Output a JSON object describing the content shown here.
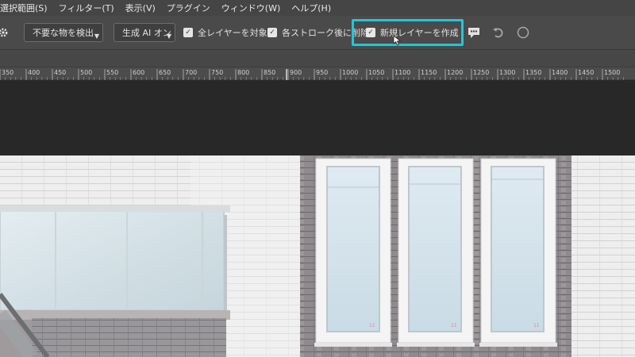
{
  "menu": {
    "items": [
      "選択範囲(S)",
      "フィルター(T)",
      "表示(V)",
      "プラグイン",
      "ウィンドウ(W)",
      "ヘルプ(H)"
    ]
  },
  "options": {
    "mode_dropdown": "不要な物を検出",
    "ai_dropdown": "生成 AI オン",
    "checkbox_all_layers": "全レイヤーを対象",
    "checkbox_delete_after": "各ストローク後に削除",
    "checkbox_new_layer": "新規レイヤーを作成",
    "checkbox_all_layers_checked": true,
    "checkbox_delete_after_checked": true,
    "checkbox_new_layer_checked": true,
    "highlight_color": "#1fc8d8"
  },
  "ruler": {
    "labels": [
      "350",
      "400",
      "450",
      "500",
      "550",
      "600",
      "650",
      "700",
      "750",
      "800",
      "850",
      "900",
      "950",
      "1000",
      "1050",
      "1100",
      "1150",
      "1200",
      "1250",
      "1300",
      "1350",
      "1400",
      "1450",
      "1500"
    ]
  },
  "icons": {
    "settings": "gear-icon",
    "feedback": "speech-bubble-icon",
    "undo": "undo-icon",
    "options": "circle-icon"
  }
}
